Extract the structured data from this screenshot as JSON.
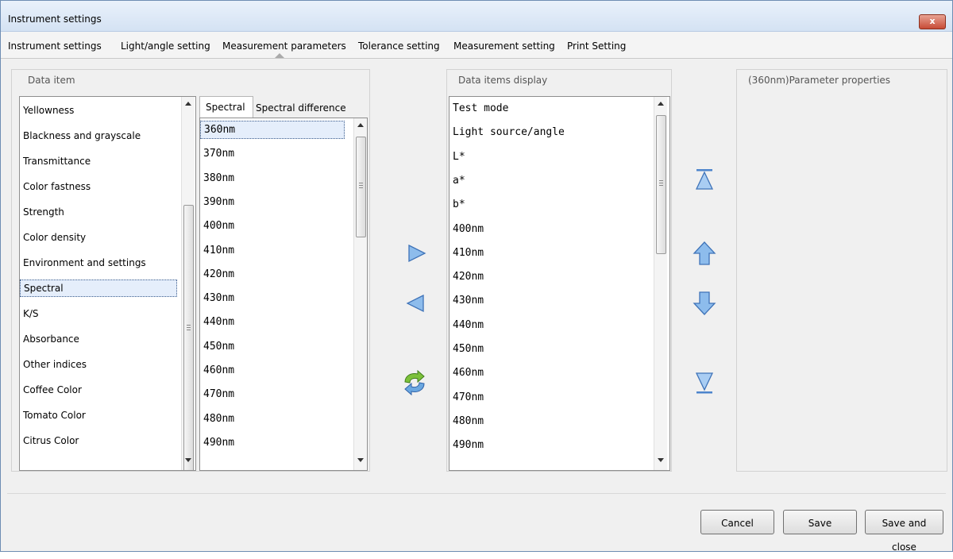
{
  "window": {
    "title": "Instrument settings",
    "close_glyph": "x"
  },
  "tabs": [
    "Instrument settings",
    "Light/angle setting",
    "Measurement parameters",
    "Tolerance setting",
    "Measurement setting",
    "Print Setting"
  ],
  "data_item": {
    "title": "Data item",
    "items": [
      "Yellowness",
      "Blackness and grayscale",
      "Transmittance",
      "Color fastness",
      "Strength",
      "Color density",
      "Environment and settings",
      "Spectral",
      "K/S",
      "Absorbance",
      "Other indices",
      "Coffee Color",
      "Tomato Color",
      "Citrus Color"
    ],
    "selected": "Spectral"
  },
  "subtabs": [
    "Spectral",
    "Spectral difference"
  ],
  "spectral_items": [
    "360nm",
    "370nm",
    "380nm",
    "390nm",
    "400nm",
    "410nm",
    "420nm",
    "430nm",
    "440nm",
    "450nm",
    "460nm",
    "470nm",
    "480nm",
    "490nm"
  ],
  "spectral_selected": "360nm",
  "display": {
    "title": "Data items display",
    "items": [
      "Test mode",
      "Light source/angle",
      "L*",
      "a*",
      "b*",
      "400nm",
      "410nm",
      "420nm",
      "430nm",
      "440nm",
      "450nm",
      "460nm",
      "470nm",
      "480nm",
      "490nm"
    ]
  },
  "properties": {
    "title": "(360nm)Parameter properties"
  },
  "buttons": {
    "cancel": "Cancel",
    "save": "Save",
    "save_close": "Save and close"
  },
  "icons": {
    "add": "arrow-right-icon",
    "remove": "arrow-left-icon",
    "refresh": "refresh-icon",
    "top": "move-top-icon",
    "up": "move-up-icon",
    "down": "move-down-icon",
    "bottom": "move-bottom-icon"
  },
  "colors": {
    "icon_blue": "#6a9fdc",
    "close_red": "#c74b36",
    "refresh_green": "#7cc13a"
  }
}
